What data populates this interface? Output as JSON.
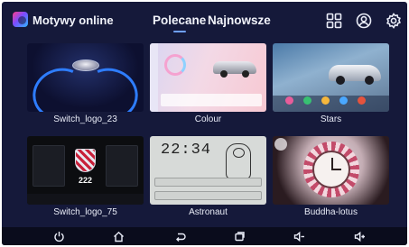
{
  "header": {
    "app_title": "Motywy online",
    "tabs": [
      {
        "label": "Polecane",
        "active": true
      },
      {
        "label": "Najnowsze",
        "active": false
      }
    ],
    "icons": [
      "grid-icon",
      "user-icon",
      "gear-icon"
    ]
  },
  "themes": [
    {
      "name": "Switch_logo_23"
    },
    {
      "name": "Colour"
    },
    {
      "name": "Stars"
    },
    {
      "name": "Switch_logo_75"
    },
    {
      "name": "Astronaut"
    },
    {
      "name": "Buddha-lotus"
    }
  ],
  "thumb_text": {
    "speed": "222",
    "clock": "22:34"
  },
  "navbar": {
    "icons": [
      "power-icon",
      "home-icon",
      "back-icon",
      "recents-icon",
      "volume-down-icon",
      "volume-up-icon"
    ]
  },
  "colors": {
    "background": "#15193a",
    "accent": "#6fa0ff",
    "navbar": "#0a0c1c"
  }
}
